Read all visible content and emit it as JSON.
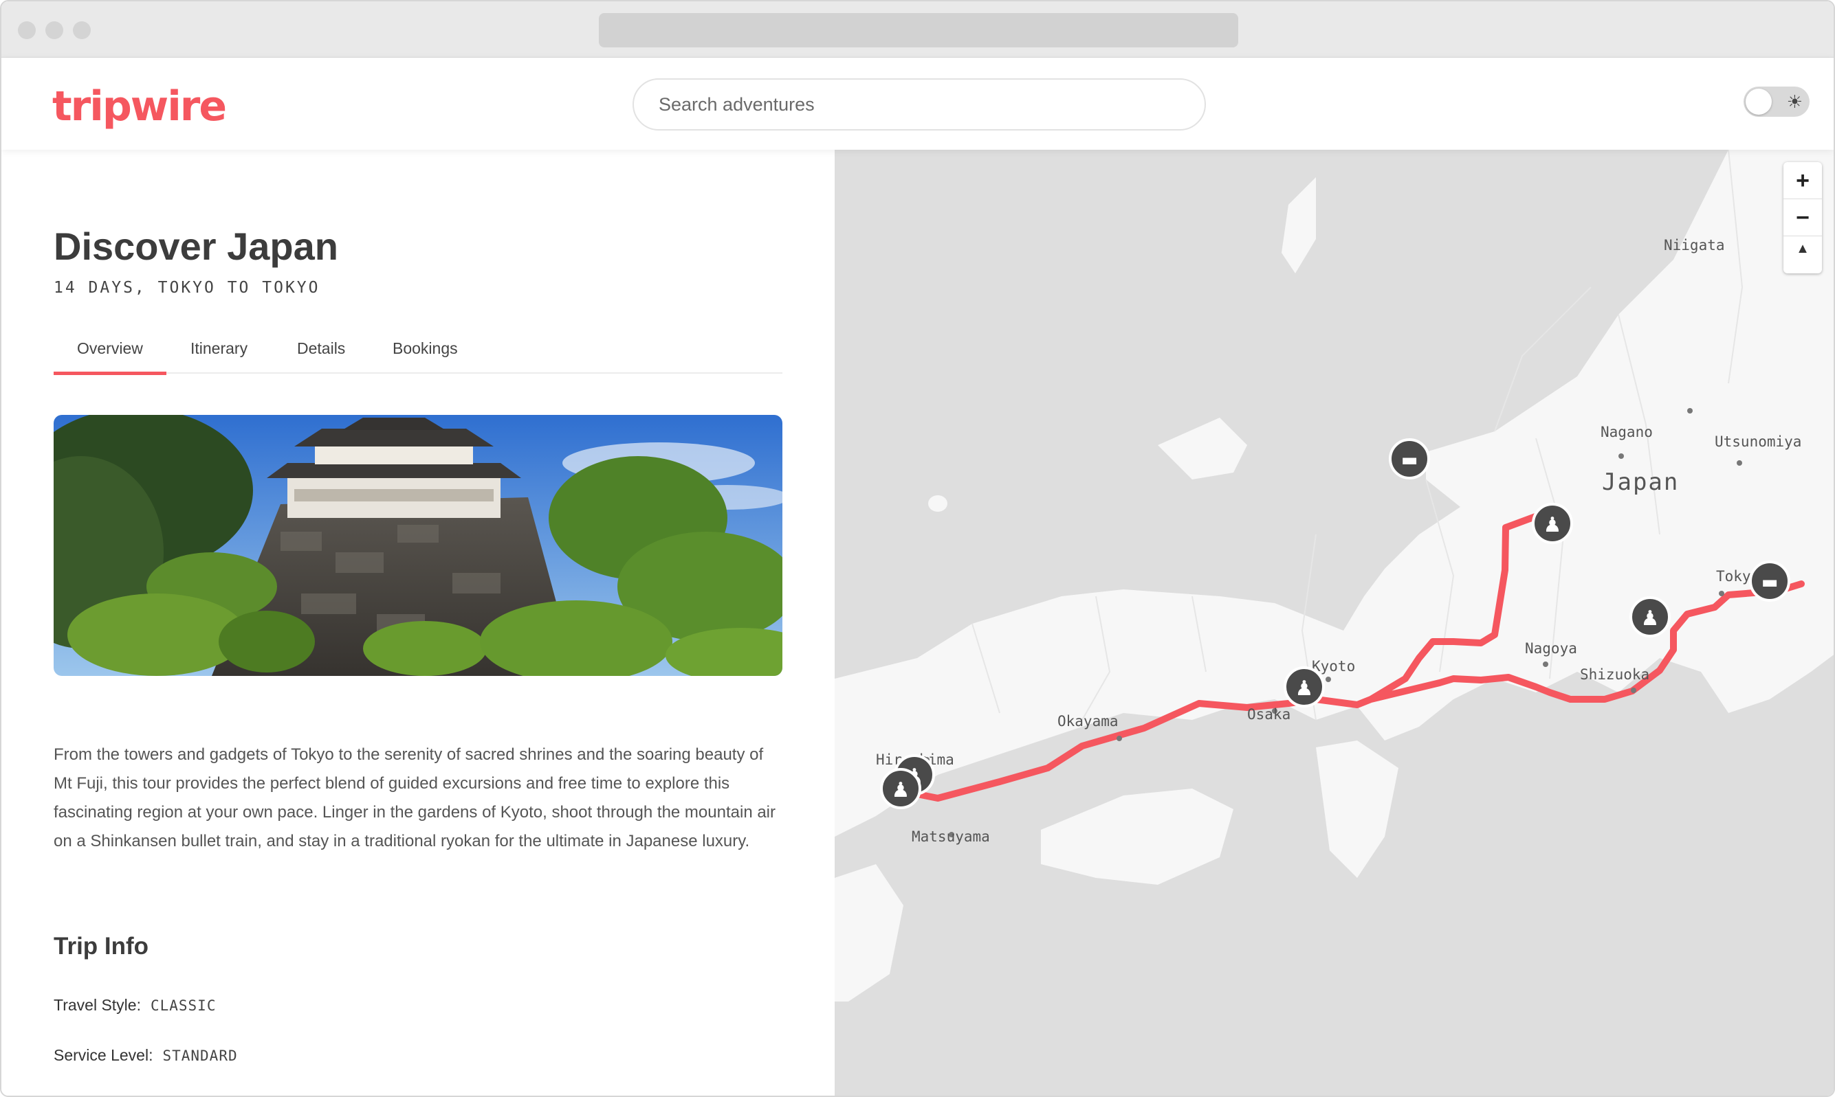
{
  "app": {
    "logo": "tripwire"
  },
  "search": {
    "placeholder": "Search adventures"
  },
  "theme_toggle": {
    "icon": "sun-icon",
    "state": "off"
  },
  "trip": {
    "title": "Discover Japan",
    "subtitle": "14 DAYS, TOKYO TO TOKYO",
    "tabs": [
      {
        "label": "Overview",
        "active": true
      },
      {
        "label": "Itinerary",
        "active": false
      },
      {
        "label": "Details",
        "active": false
      },
      {
        "label": "Bookings",
        "active": false
      }
    ],
    "description": "From the towers and gadgets of Tokyo to the serenity of sacred shrines and the soaring beauty of Mt Fuji, this tour provides the perfect blend of guided excursions and free time to explore this fascinating region at your own pace. Linger in the gardens of Kyoto, shoot through the mountain air on a Shinkansen bullet train, and stay in a traditional ryokan for the ultimate in Japanese luxury.",
    "trip_info": {
      "heading": "Trip Info",
      "travel_style_label": "Travel Style:",
      "travel_style_value": "CLASSIC",
      "service_level_label": "Service Level:",
      "service_level_value": "STANDARD"
    }
  },
  "map": {
    "controls": {
      "zoom_in": "+",
      "zoom_out": "−",
      "compass": "▲"
    },
    "country_label": "Japan",
    "places": [
      "Niigata",
      "Nagano",
      "Utsunomiya",
      "Tokyo",
      "Nagoya",
      "Shizuoka",
      "Kyoto",
      "Osaka",
      "Okayama",
      "Hiroshima",
      "Matsuyama"
    ],
    "route_color": "#f5575f",
    "markers": [
      "hotel-marker",
      "activity-marker",
      "activity-marker",
      "hotel-marker",
      "activity-marker",
      "activity-marker",
      "activity-marker"
    ]
  },
  "colors": {
    "accent": "#f5575f",
    "water": "#dedede",
    "land": "#f7f7f7"
  }
}
